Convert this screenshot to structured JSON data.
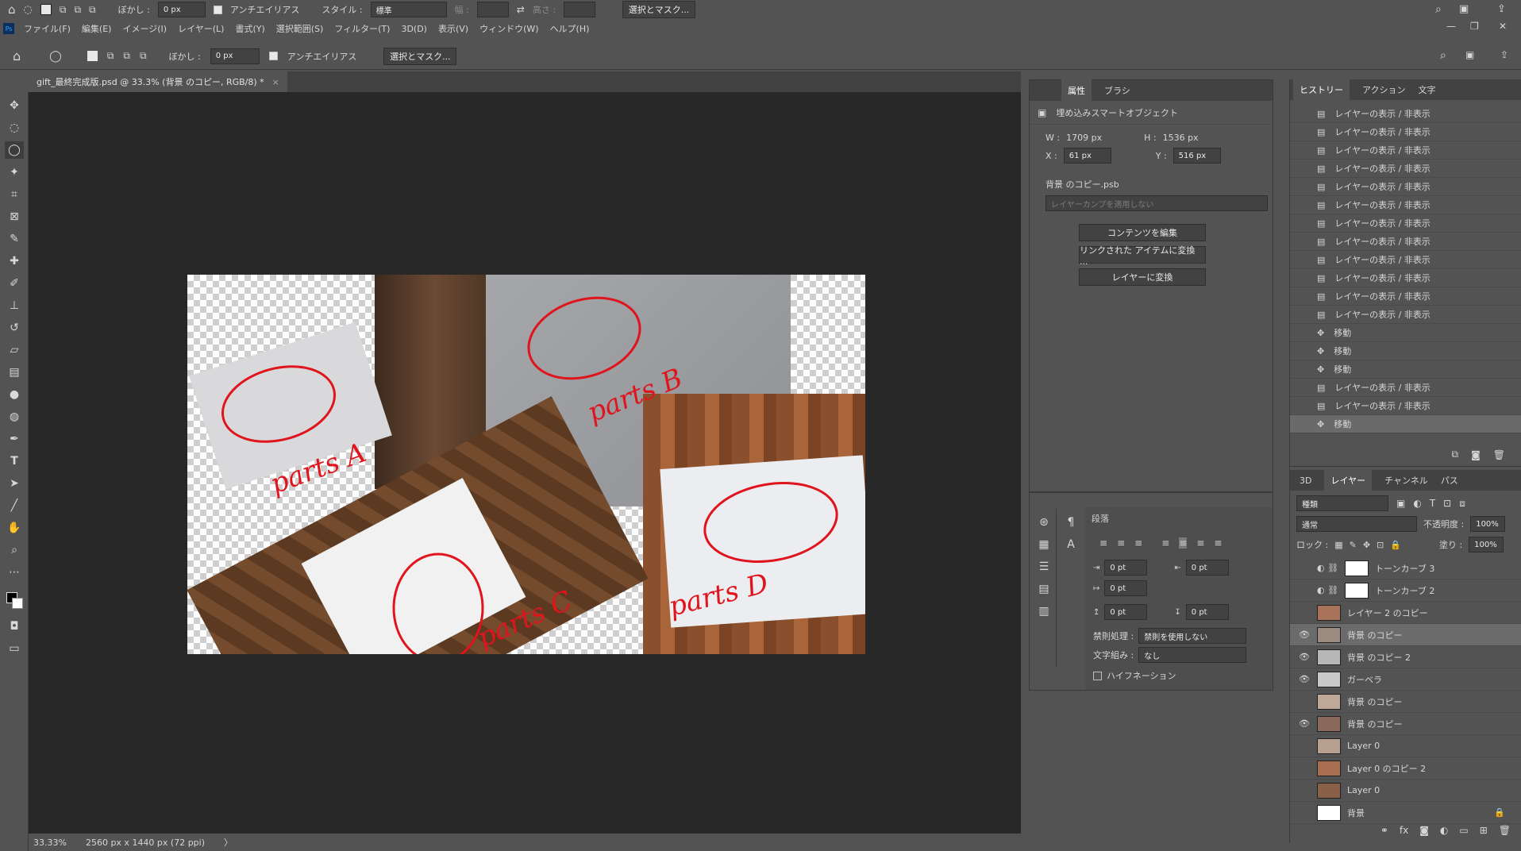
{
  "optbar": {
    "blur_label": "ぼかし :",
    "blur_value": "0 px",
    "antialias": "アンチエイリアス",
    "style_label": "スタイル :",
    "style_value": "標準",
    "width_label": "幅 :",
    "height_label": "高さ :",
    "select_mask": "選択とマスク..."
  },
  "menu": [
    "ファイル(F)",
    "編集(E)",
    "イメージ(I)",
    "レイヤー(L)",
    "書式(Y)",
    "選択範囲(S)",
    "フィルター(T)",
    "3D(D)",
    "表示(V)",
    "ウィンドウ(W)",
    "ヘルプ(H)"
  ],
  "toolbar2": {
    "blur_label": "ぼかし :",
    "blur_value": "0 px",
    "antialias": "アンチエイリアス",
    "select_mask": "選択とマスク..."
  },
  "document": {
    "tab_title": "gift_最終完成版.psd @ 33.3% (背景 のコピー, RGB/8) *",
    "close": "×"
  },
  "status": {
    "zoom": "33.33%",
    "doc_info": "2560 px x 1440 px (72 ppi)",
    "arrow": "〉"
  },
  "canvas_labels": {
    "a": "parts A",
    "b": "parts B",
    "c": "parts C",
    "d": "parts D"
  },
  "properties": {
    "tabs": [
      "属性",
      "ブラシ"
    ],
    "type": "埋め込みスマートオブジェクト",
    "w_label": "W :",
    "w_value": "1709 px",
    "h_label": "H :",
    "h_value": "1536 px",
    "x_label": "X :",
    "x_value": "61 px",
    "y_label": "Y :",
    "y_value": "516 px",
    "file": "背景 のコピー.psb",
    "comp_placeholder": "レイヤーカンプを適用しない",
    "buttons": [
      "コンテンツを編集",
      "リンクされた アイテムに変換 ...",
      "レイヤーに変換"
    ]
  },
  "paragraph": {
    "tab": "段落",
    "indent_left": "0 pt",
    "indent_right": "0 pt",
    "indent_first": "0 pt",
    "space_before": "0 pt",
    "space_after": "0 pt",
    "kinsoku_label": "禁則処理 :",
    "kinsoku_value": "禁則を使用しない",
    "mojigumi_label": "文字組み :",
    "mojigumi_value": "なし",
    "hyphenation": "ハイフネーション"
  },
  "history": {
    "tabs": [
      "ヒストリー",
      "アクション",
      "文字"
    ],
    "items": [
      "レイヤーの表示 / 非表示",
      "レイヤーの表示 / 非表示",
      "レイヤーの表示 / 非表示",
      "レイヤーの表示 / 非表示",
      "レイヤーの表示 / 非表示",
      "レイヤーの表示 / 非表示",
      "レイヤーの表示 / 非表示",
      "レイヤーの表示 / 非表示",
      "レイヤーの表示 / 非表示",
      "レイヤーの表示 / 非表示",
      "レイヤーの表示 / 非表示",
      "レイヤーの表示 / 非表示",
      "移動",
      "移動",
      "移動",
      "レイヤーの表示 / 非表示",
      "レイヤーの表示 / 非表示",
      "移動"
    ]
  },
  "layers": {
    "tabs": [
      "3D",
      "レイヤー",
      "チャンネル",
      "パス"
    ],
    "filter": "種類",
    "blend": "通常",
    "opacity_label": "不透明度 :",
    "opacity": "100%",
    "lock_label": "ロック :",
    "fill_label": "塗り :",
    "fill": "100%",
    "items": [
      {
        "name": "トーンカーブ 3",
        "visible": false,
        "adj": true
      },
      {
        "name": "トーンカーブ 2",
        "visible": false,
        "adj": true
      },
      {
        "name": "レイヤー 2 のコピー",
        "visible": false,
        "adj": false
      },
      {
        "name": "背景 のコピー",
        "visible": true,
        "adj": false,
        "selected": true
      },
      {
        "name": "背景 のコピー 2",
        "visible": true,
        "adj": false
      },
      {
        "name": "ガーベラ",
        "visible": true,
        "adj": false
      },
      {
        "name": "背景 のコピー",
        "visible": false,
        "adj": false
      },
      {
        "name": "背景 のコピー",
        "visible": true,
        "adj": false
      },
      {
        "name": "Layer 0",
        "visible": false,
        "adj": false
      },
      {
        "name": "Layer 0 のコピー 2",
        "visible": false,
        "adj": false
      },
      {
        "name": "Layer 0",
        "visible": false,
        "adj": false
      },
      {
        "name": "背景",
        "visible": false,
        "adj": false,
        "locked": true
      }
    ]
  }
}
